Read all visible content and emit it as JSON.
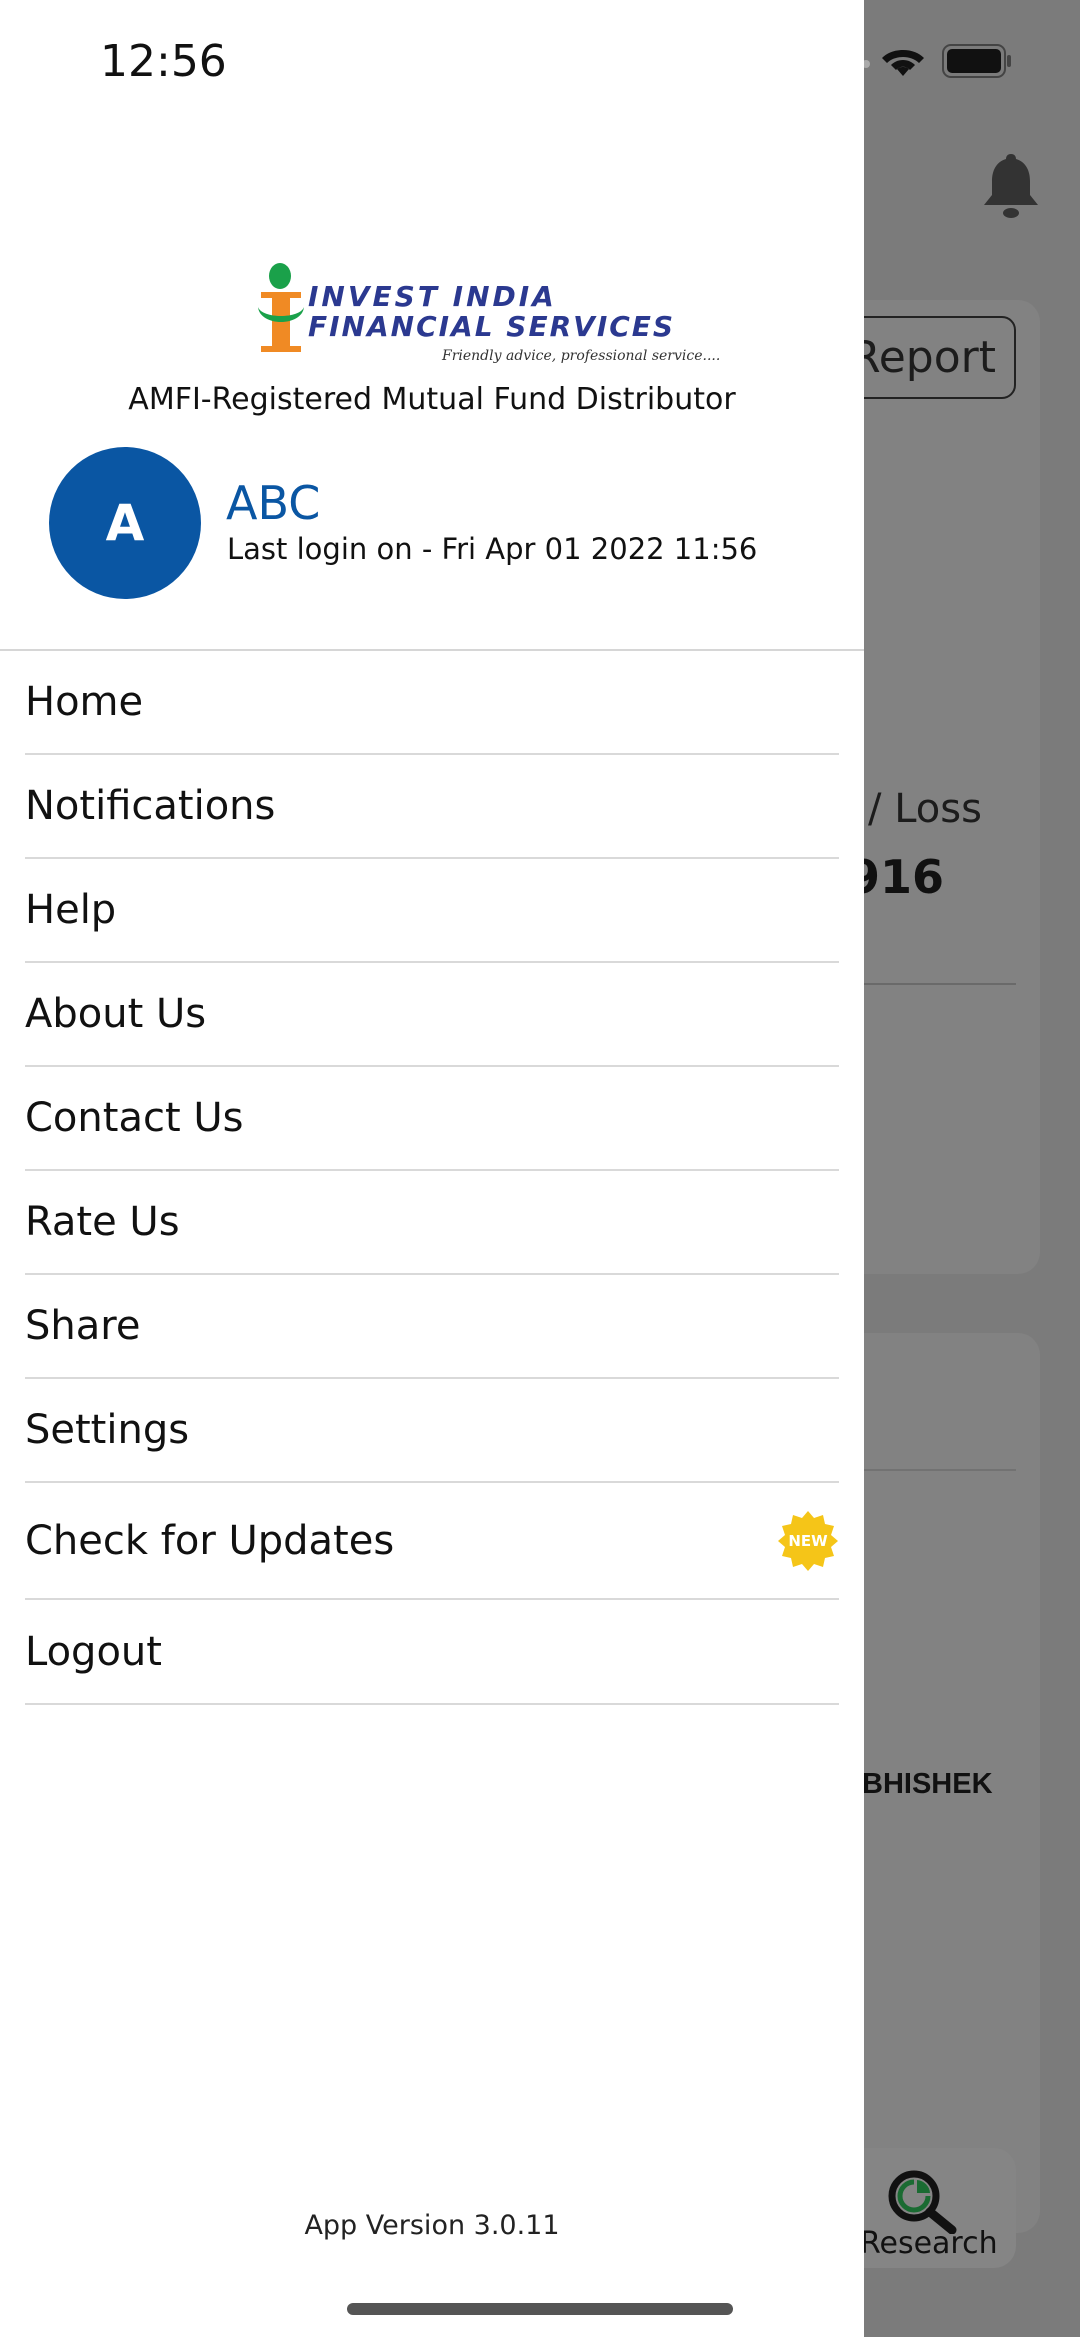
{
  "status_bar": {
    "time": "12:56"
  },
  "logo": {
    "line1": "INVEST INDIA",
    "line2": "FINANCIAL SERVICES",
    "tagline": "Friendly advice, professional service...."
  },
  "drawer": {
    "subtitle": "AMFI-Registered Mutual Fund Distributor",
    "user": {
      "avatar_letter": "A",
      "name": "ABC",
      "last_login": "Last login on - Fri Apr 01 2022 11:56"
    },
    "menu": [
      {
        "label": "Home"
      },
      {
        "label": "Notifications"
      },
      {
        "label": "Help"
      },
      {
        "label": "About Us"
      },
      {
        "label": "Contact Us"
      },
      {
        "label": "Rate Us"
      },
      {
        "label": "Share"
      },
      {
        "label": "Settings"
      },
      {
        "label": "Check for Updates",
        "badge": "NEW"
      },
      {
        "label": "Logout"
      }
    ],
    "app_version": "App Version 3.0.11"
  },
  "background": {
    "report_button": "Report",
    "profit_loss_label": "/ Loss",
    "profit_loss_value": "916",
    "name_fragment": "BHISHEK",
    "research_label": "Research"
  },
  "colors": {
    "accent": "#0a56a3",
    "badge": "#f5c518",
    "overlay": "#7b7b7b",
    "research_green": "#1a6b32"
  }
}
